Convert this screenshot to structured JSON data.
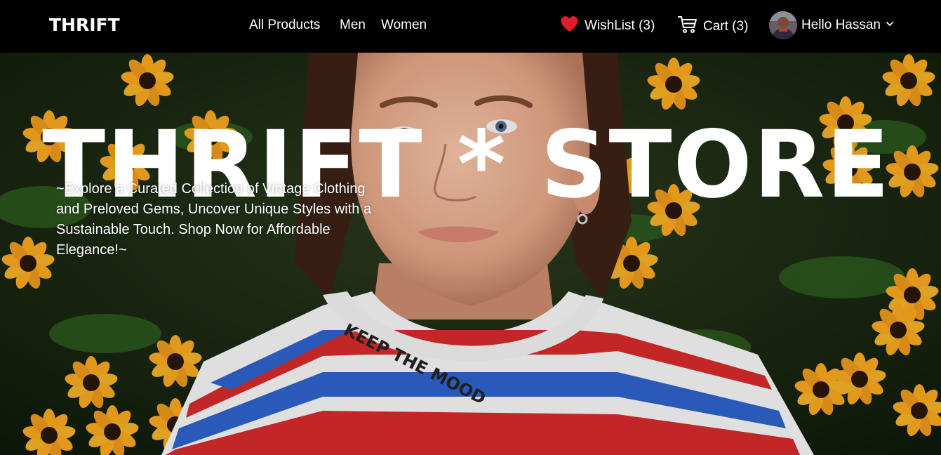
{
  "navbar": {
    "logo": "THRIFT",
    "links": [
      {
        "label": "All Products"
      },
      {
        "label": "Men"
      },
      {
        "label": "Women"
      }
    ],
    "wishlist": {
      "label": "WishList (3)",
      "icon": "heart-icon",
      "color": "#e11d2a"
    },
    "cart": {
      "label": "Cart (3)",
      "icon": "cart-icon"
    },
    "user": {
      "greeting": "Hello Hassan",
      "icon": "chevron-down-icon"
    }
  },
  "hero": {
    "title": "THRIFT * STORE",
    "tagline": "~Explore a Curated Collection of Vintage Clothing and Preloved Gems, Uncover Unique Styles with a Sustainable Touch. Shop Now for Affordable Elegance!~",
    "image_text": "KEEP THE MOOD"
  },
  "colors": {
    "nav_bg": "#000000",
    "text": "#ffffff",
    "accent_red": "#e11d2a"
  }
}
